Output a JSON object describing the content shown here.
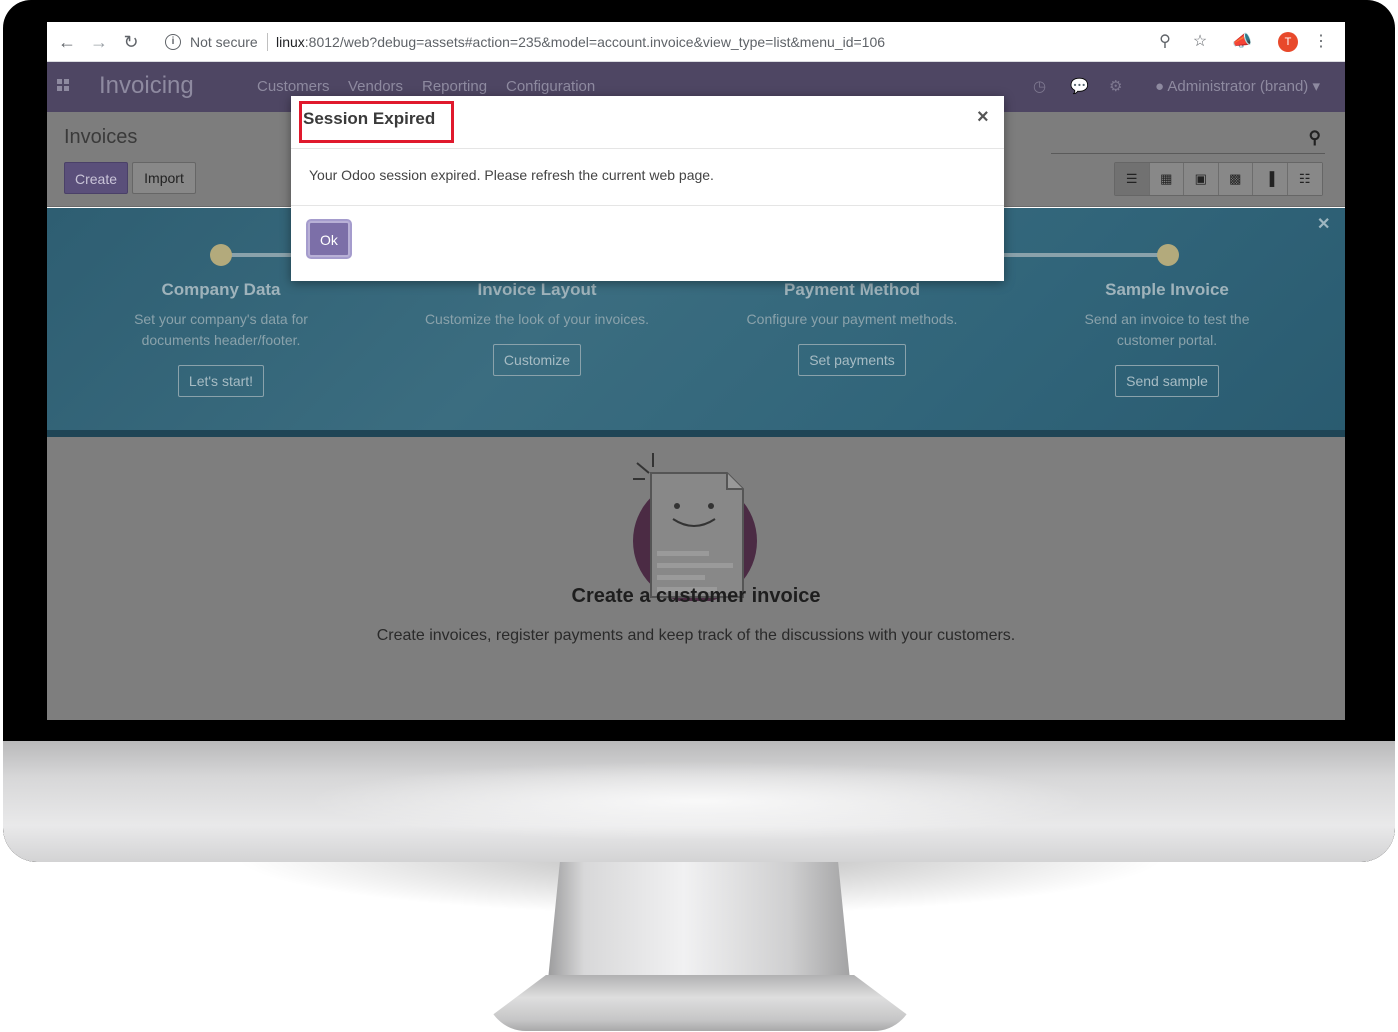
{
  "browser": {
    "security_label": "Not secure",
    "url_host": "linux",
    "url_rest": ":8012/web?debug=assets#action=235&model=account.invoice&view_type=list&menu_id=106",
    "profile_initial": "T"
  },
  "navbar": {
    "app_name": "Invoicing",
    "menu": [
      "Customers",
      "Vendors",
      "Reporting",
      "Configuration"
    ],
    "user": "Administrator (brand)"
  },
  "control": {
    "title": "Invoices",
    "create_label": "Create",
    "import_label": "Import"
  },
  "onboarding": {
    "steps": [
      {
        "title": "Company Data",
        "desc": "Set your company's data for documents header/footer.",
        "button": "Let's start!"
      },
      {
        "title": "Invoice Layout",
        "desc": "Customize the look of your invoices.",
        "button": "Customize"
      },
      {
        "title": "Payment Method",
        "desc": "Configure your payment methods.",
        "button": "Set payments"
      },
      {
        "title": "Sample Invoice",
        "desc": "Send an invoice to test the customer portal.",
        "button": "Send sample"
      }
    ]
  },
  "empty": {
    "title": "Create a customer invoice",
    "desc": "Create invoices, register payments and keep track of the discussions with your customers."
  },
  "modal": {
    "title": "Session Expired",
    "body": "Your Odoo session expired. Please refresh the current web page.",
    "ok_label": "Ok",
    "close_symbol": "×"
  },
  "colors": {
    "navbar": "#4e4663",
    "primary": "#7c6fa8",
    "highlight": "#e0192d",
    "onboarding": "#3b6d80"
  }
}
